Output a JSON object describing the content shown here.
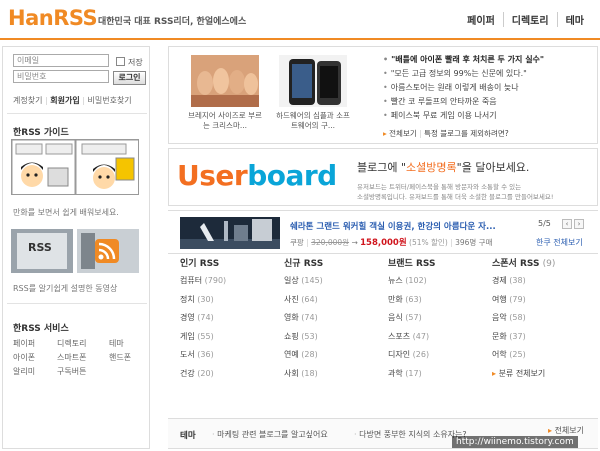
{
  "header": {
    "logo_main": "HanRSS",
    "slogan": "대한민국 대표 RSS리더, 한얼에스에스",
    "nav": [
      "페이퍼",
      "디렉토리",
      "테마"
    ]
  },
  "login": {
    "id_placeholder": "이메일",
    "pw_placeholder": "비밀번호",
    "save_label": "저장",
    "login_button": "로그인",
    "links": [
      "계정찾기",
      "회원가입",
      "비밀번호찾기"
    ]
  },
  "guide": {
    "title": "한RSS 가이드",
    "comic_caption": "만화를 보면서 쉽게 배워보세요.",
    "rss_caption": "RSS를 알기쉽게 설명한 동영상"
  },
  "services": {
    "title": "한RSS 서비스",
    "items": [
      "페이퍼",
      "디렉토리",
      "테마",
      "아이폰",
      "스마트폰",
      "핸드폰",
      "알리미",
      "구독버튼"
    ]
  },
  "featured": {
    "thumb1_caption": "브레지어 사이즈로 부르는 크리스마...",
    "thumb2_caption": "하드웨어의 심플과 소프트웨어의 구...",
    "headline": "\"배틀에 아이폰 빨래 후 처치른 두 가지 실수\"",
    "news": [
      "\"모든 고급 정보의 99%는 신문에 있다.\"",
      "아름스토어는 원래 이렇게 배송이 늦나",
      "빨간 코 루돌프의 안타까운 죽음",
      "페이스북 무료 게임 이용 나서기"
    ],
    "more": "전체보기",
    "more_desc": "특정 블로그를 제외하려면?"
  },
  "userboard": {
    "logo_u": "User",
    "logo_rest": "board",
    "tagline_pre": "블로그에 \"",
    "tagline_hl": "소셜방명록",
    "tagline_post": "\"을 달아보세요.",
    "desc1": "유저보드는 트위터/페이스북을 통해 방문자와 소통할 수 있는",
    "desc2": "소셜방명록입니다. 유저보드를 통해 더욱 소셜한 블로그를 만들어보세요!"
  },
  "deal": {
    "title": "쉐라톤 그랜드 워커힐 객실 이용권, 한강의 아름다운 자...",
    "price_label": "쿠팡",
    "old_price": "320,000원",
    "new_price": "158,000원",
    "discount": "(51% 할인)",
    "sold": "396명 구매",
    "page": "5/5",
    "more": "한쿠 전체보기"
  },
  "rss": {
    "columns": [
      {
        "title": "인기 RSS",
        "items": [
          [
            "컴퓨터",
            "(790)"
          ],
          [
            "정치",
            "(30)"
          ],
          [
            "경영",
            "(74)"
          ],
          [
            "게임",
            "(55)"
          ],
          [
            "도서",
            "(36)"
          ],
          [
            "건강",
            "(20)"
          ]
        ]
      },
      {
        "title": "신규 RSS",
        "items": [
          [
            "일상",
            "(145)"
          ],
          [
            "사진",
            "(64)"
          ],
          [
            "영화",
            "(74)"
          ],
          [
            "쇼핑",
            "(53)"
          ],
          [
            "연예",
            "(28)"
          ],
          [
            "사회",
            "(18)"
          ]
        ]
      },
      {
        "title": "브랜드 RSS",
        "items": [
          [
            "뉴스",
            "(102)"
          ],
          [
            "만화",
            "(63)"
          ],
          [
            "음식",
            "(57)"
          ],
          [
            "스포츠",
            "(47)"
          ],
          [
            "디자인",
            "(26)"
          ],
          [
            "과학",
            "(17)"
          ]
        ]
      },
      {
        "title": "스폰서 RSS",
        "count": "(9)",
        "items": [
          [
            "경제",
            "(38)"
          ],
          [
            "여행",
            "(79)"
          ],
          [
            "음악",
            "(58)"
          ],
          [
            "문화",
            "(37)"
          ],
          [
            "어학",
            "(25)"
          ]
        ]
      }
    ],
    "more": "분류 전체보기"
  },
  "theme": {
    "label": "테마",
    "items": [
      "마케팅 관련 블로그를 알고싶어요",
      "다방면 풍부한 지식의 소유자는?"
    ],
    "more": "전체보기"
  },
  "watermark": "http://wiinemo.tistory.com",
  "colors": {
    "accent": "#f08a24",
    "userboard_blue": "#0aa5d8",
    "userboard_orange": "#f36f21",
    "deal_title": "#2a5db0",
    "price_red": "#d0141c"
  }
}
